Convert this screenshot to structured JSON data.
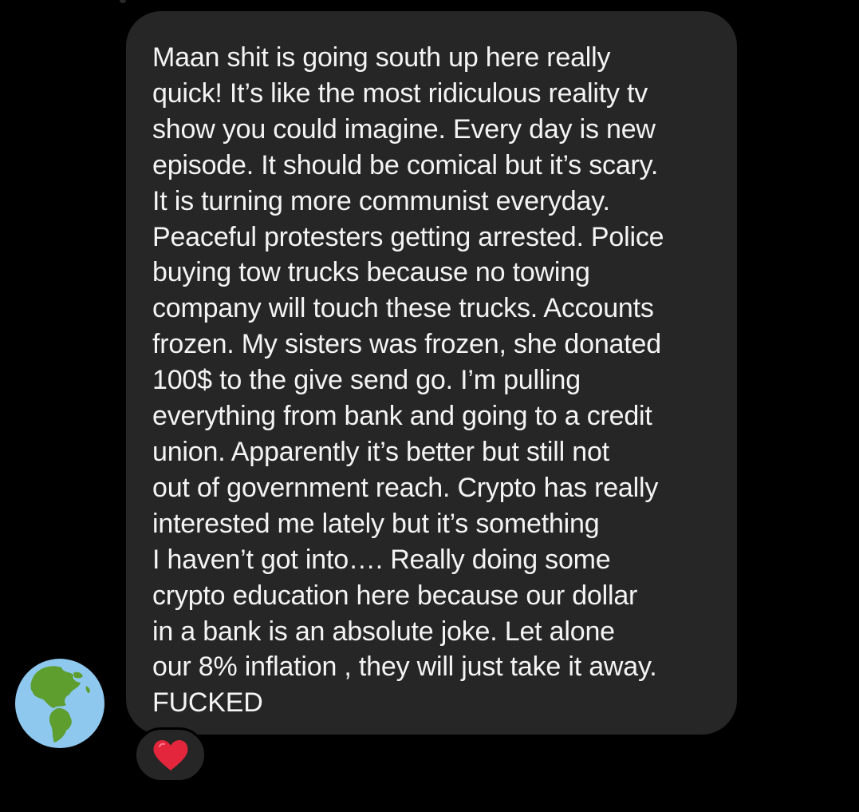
{
  "conversation": {
    "message": {
      "lines": [
        "Maan shit is going south up here really",
        "quick! It’s like the most ridiculous reality tv",
        "show you could imagine. Every day is new",
        "episode. It should be comical but it’s scary.",
        "It is turning more communist everyday.",
        "Peaceful protesters getting arrested. Police",
        "buying tow trucks because no towing",
        "company will touch these trucks. Accounts",
        "frozen. My sisters was frozen, she donated",
        "100$ to the give send go. I’m pulling",
        "everything from bank and going to a credit",
        "union. Apparently it’s better but still not",
        "out of government reach. Crypto has really",
        "interested me lately but it’s something",
        "I haven’t got into…. Really doing some",
        "crypto education here because our dollar",
        "in a bank is an absolute joke. Let alone",
        "our 8% inflation , they will just take it away.",
        "FUCKED"
      ]
    },
    "avatar": {
      "icon": "globe-americas-icon"
    },
    "reaction": {
      "icon": "red-heart-icon",
      "color": "#e3263c"
    }
  },
  "colors": {
    "background": "#000000",
    "bubble": "#262626",
    "text": "#f4f4f4",
    "globe_ocean": "#8ec8ef",
    "globe_land": "#5d9e2f"
  }
}
